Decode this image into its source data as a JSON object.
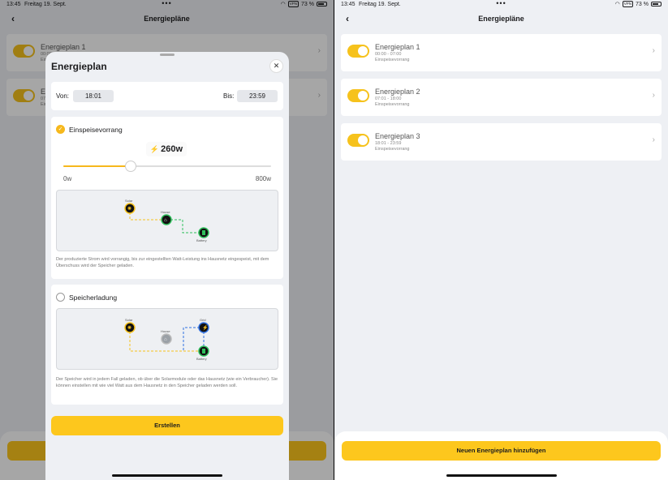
{
  "status": {
    "time": "13:45",
    "date": "Freitag 19. Sept.",
    "battery": "73 %",
    "vpn": "VPN"
  },
  "nav": {
    "title": "Energiepläne",
    "back_icon": "chevron-left-icon"
  },
  "plans": [
    {
      "name": "Energieplan 1",
      "time": "00:00 - 07:00",
      "mode": "Einspeisevorrang",
      "enabled": true
    },
    {
      "name": "Energieplan 2",
      "time": "07:01 - 18:00",
      "mode": "Einspeisevorrang",
      "enabled": true
    },
    {
      "name": "Energieplan 3",
      "time": "18:01 - 23:59",
      "mode": "Einspeisevorrang",
      "enabled": true
    }
  ],
  "add_button": "Neuen Energieplan hinzufügen",
  "sheet": {
    "title": "Energieplan",
    "from_label": "Von:",
    "from_value": "18:01",
    "to_label": "Bis:",
    "to_value": "23:59",
    "option1": {
      "label": "Einspeisevorrang",
      "selected": true,
      "power": "260w",
      "slider_fraction": 0.325,
      "min_label": "0w",
      "max_label": "800w",
      "desc": "Der produzierte Strom wird vorrangig, bis zur eingestellten Watt-Leistung ins Hausnetz eingespeist, mit dem Überschuss wird der Speicher geladen."
    },
    "option2": {
      "label": "Speicherladung",
      "selected": false,
      "desc": "Der Speicher wird in jedem Fall geladen, ob über die Solarmodule oder das Hausnetz (wie ein Verbraucher). Sie können einstellen mit wie viel Watt aus dem Hausnetz in den Speicher geladen werden soll."
    },
    "create_button": "Erstellen",
    "diagram_labels": {
      "solar": "Solar",
      "house": "House",
      "battery": "Battery",
      "grid": "Grid"
    }
  },
  "colors": {
    "accent": "#fdc71d",
    "green": "#2fbf5b",
    "blue": "#2f6fe0"
  }
}
